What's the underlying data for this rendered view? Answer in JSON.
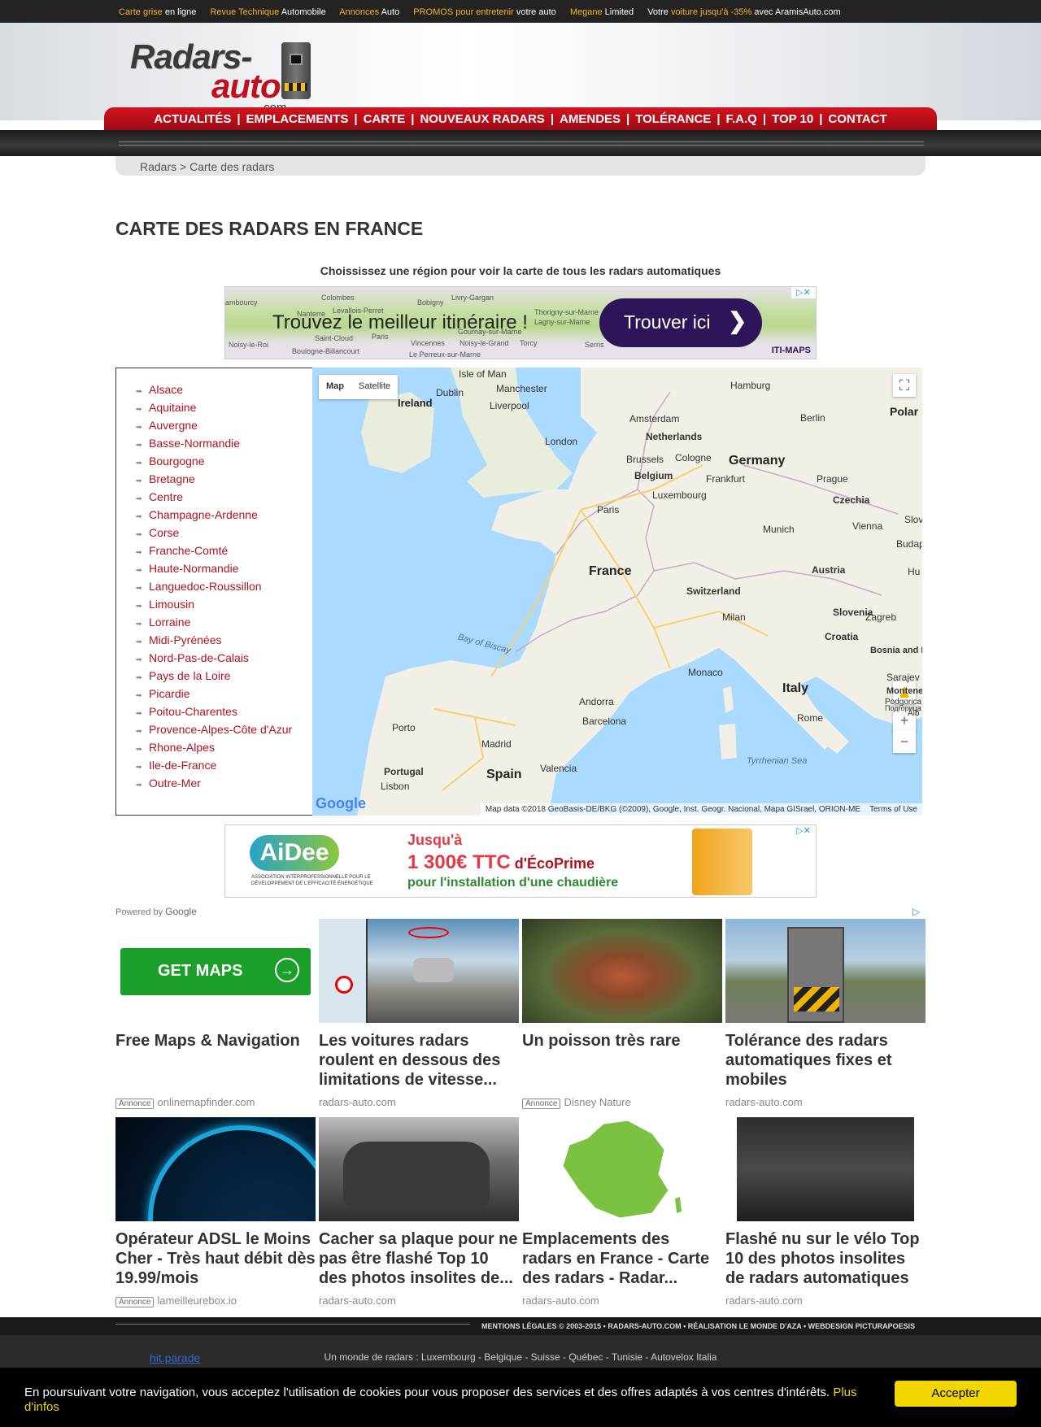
{
  "topbar": {
    "links": [
      {
        "hl": "Carte grise",
        "rest": " en ligne"
      },
      {
        "hl": "Revue Technique",
        "rest": " Automobile"
      },
      {
        "hl": "Annonces",
        "rest": " Auto"
      },
      {
        "hl": "PROMOS pour entretenir",
        "rest": " votre auto"
      },
      {
        "hl": "Megane",
        "rest": " Limited"
      }
    ],
    "last": {
      "pre": "Votre ",
      "hl": "voiture jusqu'à -35%",
      "rest": " avec AramisAuto.com"
    }
  },
  "logo": {
    "line1": "Radars-",
    "line2": "auto",
    "line3": ".com"
  },
  "nav": [
    "ACTUALITÉS",
    "EMPLACEMENTS",
    "CARTE",
    "NOUVEAUX RADARS",
    "AMENDES",
    "TOLÉRANCE",
    "F.A.Q",
    "TOP 10",
    "CONTACT"
  ],
  "breadcrumb": "Radars > Carte des radars",
  "page_title": "CARTE DES RADARS EN FRANCE",
  "subtitle": "Choississez une région pour voir la carte de tous les radars automatiques",
  "ad1": {
    "headline": "Trouvez le meilleur itinéraire !",
    "button": "Trouver ici",
    "brand": "ITI-MAPS",
    "places": [
      "Colombes",
      "Bobigny",
      "Livry-Gargan",
      "Nanterre",
      "Levallois-Perret",
      "Paris",
      "Saint-Cloud",
      "Boulogne-Billancourt",
      "Vincennes",
      "Noisy-le-Grand",
      "Torcy",
      "Serris",
      "Noisy-le-Roi",
      "Le Perreux-sur-Marne",
      "Gournay-sur-Marne",
      "Thorigny-sur-Marne",
      "Lagny-sur-Marne",
      "ambourcy"
    ]
  },
  "regions": [
    "Alsace",
    "Aquitaine",
    "Auvergne",
    "Basse-Normandie",
    "Bourgogne",
    "Bretagne",
    "Centre",
    "Champagne-Ardenne",
    "Corse",
    "Franche-Comté",
    "Haute-Normandie",
    "Languedoc-Roussillon",
    "Limousin",
    "Lorraine",
    "Midi-Pyrénées",
    "Nord-Pas-de-Calais",
    "Pays de la Loire",
    "Picardie",
    "Poitou-Charentes",
    "Provence-Alpes-Côte d'Azur",
    "Rhone-Alpes",
    "Ile-de-France",
    "Outre-Mer"
  ],
  "map": {
    "type_buttons": [
      "Map",
      "Satellite"
    ],
    "labels": {
      "isle_of_man": "Isle of Man",
      "manchester": "Manchester",
      "hamburg": "Hamburg",
      "ireland": "Ireland",
      "dublin": "Dublin",
      "liverpool": "Liverpool",
      "berlin": "Berlin",
      "polar": "Polar",
      "amsterdam": "Amsterdam",
      "netherlands": "Netherlands",
      "london": "London",
      "brussels": "Brussels",
      "cologne": "Cologne",
      "germany": "Germany",
      "belgium": "Belgium",
      "frankfurt": "Frankfurt",
      "prague": "Prague",
      "luxembourg": "Luxembourg",
      "czechia": "Czechia",
      "paris": "Paris",
      "munich": "Munich",
      "vienna": "Vienna",
      "austria": "Austria",
      "slov": "Slov",
      "buda": "Budap",
      "france": "France",
      "switzerland": "Switzerland",
      "slovenia": "Slovenia",
      "zagreb": "Zagreb",
      "milan": "Milan",
      "croatia": "Croatia",
      "bay": "Bay of Biscay",
      "bosnia": "Bosnia and Herzegovina",
      "monaco": "Monaco",
      "sarajevo": "Sarajev",
      "italy": "Italy",
      "andorra": "Andorra",
      "podgorica": "Podgorica",
      "montene": "Montene",
      "barcelona": "Barcelona",
      "rome": "Rome",
      "porto": "Porto",
      "madrid": "Madrid",
      "tyrrhenian": "Tyrrhenian Sea",
      "portugal": "Portugal",
      "valencia": "Valencia",
      "spain": "Spain",
      "lisbon": "Lisbon",
      "hu": "Hu",
      "alb": "Alb",
      "po": "Подгорица"
    },
    "attribution": "Map data ©2018 GeoBasis-DE/BKG (©2009), Google, Inst. Geogr. Nacional, Mapa GISrael, ORION-ME",
    "terms": "Terms of Use",
    "google": "Google"
  },
  "ad2": {
    "logo": "AiDee",
    "tagline": "ASSOCIATION INTERPROFESSIONNELLE POUR LE DÉVELOPPEMENT DE L'EFFICACITÉ ÉNERGÉTIQUE",
    "line1": "Jusqu'à",
    "amount": "1 300€ TTC",
    "amount_suffix": " d'ÉcoPrime",
    "line3": "pour l'installation d'une chaudière"
  },
  "powered_by": "Powered by",
  "powered_brand": "Google",
  "cards": [
    {
      "title": "Free Maps & Navigation",
      "badge": "Annonce",
      "source": "onlinemapfinder.com",
      "button": "GET MAPS"
    },
    {
      "title": "Les voitures radars roulent en dessous des limitations de vitesse...",
      "badge": "",
      "source": "radars-auto.com"
    },
    {
      "title": "Un poisson très rare",
      "badge": "Annonce",
      "source": "Disney Nature"
    },
    {
      "title": "Tolérance des radars automatiques fixes et mobiles",
      "badge": "",
      "source": "radars-auto.com"
    },
    {
      "title": "Opérateur ADSL le Moins Cher - Très haut débit dès 19.99/mois",
      "badge": "Annonce",
      "source": "lameilleurebox.io"
    },
    {
      "title": "Cacher sa plaque pour ne pas être flashé Top 10 des photos insolites de...",
      "badge": "",
      "source": "radars-auto.com"
    },
    {
      "title": "Emplacements des radars en France - Carte des radars - Radar...",
      "badge": "",
      "source": "radars-auto.com"
    },
    {
      "title": "Flashé nu sur le vélo Top 10 des photos insolites de radars automatiques",
      "badge": "",
      "source": "radars-auto.com"
    }
  ],
  "footer": {
    "legal": "MENTIONS LÉGALES      © 2003-2015 • RADARS-AUTO.COM • RÉALISATION LE MONDE D'AZA • WEBDESIGN PICTURAPOESIS",
    "worlds": "Un monde de radars : Luxembourg - Belgique - Suisse - Québec - Tunisie - Autovelox Italia",
    "hit": "hit.parade"
  },
  "cookie": {
    "message": "En poursuivant votre navigation, vous acceptez l'utilisation de cookies pour vous proposer des services et des offres adaptés à vos centres d'intérêts. ",
    "more": "Plus d'infos",
    "accept": "Accepter"
  },
  "colors": {
    "brand_red": "#c0101e",
    "link_red": "#b0121e",
    "topbar_highlight": "#f0b429",
    "cookie_button": "#f1d600"
  }
}
